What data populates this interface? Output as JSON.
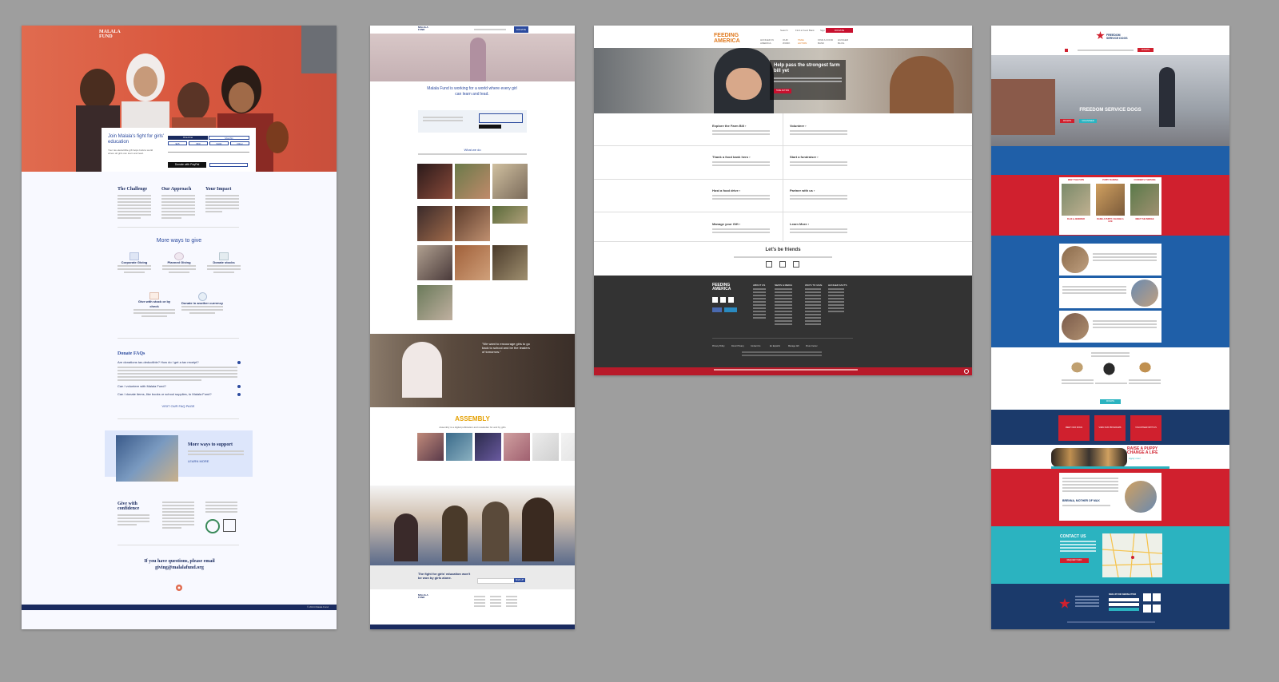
{
  "colors": {
    "canvas": "#9e9e9e",
    "malala_navy": "#1a2b5f",
    "malala_blue": "#2b4a9e",
    "feeding_red": "#c8102e",
    "feeding_orange": "#e07a1f",
    "fsd_red": "#d0202e",
    "fsd_navy": "#1b3a6b",
    "fsd_blue": "#1f5fa8",
    "fsd_teal": "#2bb3c0"
  },
  "panel1": {
    "logo": "MALALA\nFUND",
    "join_title": "Join Malala's fight for girls' education",
    "join_sub": "Your tax-deductible gift helps build a world where all girls can learn and lead.",
    "amounts": [
      "One-time",
      "Monthly",
      "$25",
      "$50",
      "$100",
      "Other"
    ],
    "donate_btn": "Donate with PayPal",
    "cols": [
      {
        "title": "The Challenge"
      },
      {
        "title": "Our Approach"
      },
      {
        "title": "Your Impact"
      }
    ],
    "more_ways_title": "More ways to give",
    "ways": [
      {
        "label": "Corporate Giving",
        "icon": "building-icon"
      },
      {
        "label": "Planned Giving",
        "icon": "heart-icon"
      },
      {
        "label": "Donate stocks",
        "icon": "chart-icon"
      },
      {
        "label": "Give with stock or by check",
        "icon": "mail-icon"
      },
      {
        "label": "Donate in another currency",
        "icon": "globe-icon"
      }
    ],
    "faq_title": "Donate FAQs",
    "faqs": [
      "Are donations tax-deductible? How do I get a tax receipt?",
      "Can I volunteer with Malala Fund?",
      "Can I donate items, like books or school supplies, to Malala Fund?"
    ],
    "faq_link": "VISIT OUR FAQ PAGE",
    "support_title": "More ways to support",
    "support_link": "LEARN MORE",
    "confidence_title": "Give with confidence",
    "questions": "If you have questions, please email giving@malalafund.org",
    "footer": "© 2024 Malala Fund"
  },
  "panel2": {
    "logo": "MALALA\nFUND",
    "nav_btn": "DONATE",
    "headline": "Malala Fund is working for a world where every girl can learn and lead.",
    "join_caption": "Join us",
    "what_we_do": "What we do",
    "quote": "\"We want to encourage girls to go back to school and be the leaders of tomorrow.\"",
    "assembly": "ASSEMBLY",
    "assembly_sub": "Assembly is a digital publication and newsletter for and by girls",
    "newsletter_title": "The fight for girls' education won't be won by girls alone.",
    "newsletter_btn": "SIGN UP"
  },
  "panel3": {
    "logo_top": "FEEDING",
    "logo_bottom": "AMERICA",
    "utility": [
      "Search",
      "Find a Food Bank",
      "Sign Up"
    ],
    "donate_btn": "DONATE",
    "nav": [
      "HUNGER IN AMERICA",
      "OUR WORK",
      "TAKE ACTION",
      "FIND A FOOD BANK",
      "HUNGER BLOG"
    ],
    "hero_title": "Help pass the strongest farm bill yet",
    "hero_btn": "TAKE ACTION",
    "cards": [
      {
        "title": "Explore the Farm Bill ›"
      },
      {
        "title": "Volunteer ›"
      },
      {
        "title": "Thank a food bank hero ›"
      },
      {
        "title": "Start a fundraiser ›"
      },
      {
        "title": "Host a food drive ›"
      },
      {
        "title": "Partner with us ›"
      },
      {
        "title": "Manage your Gift ›"
      },
      {
        "title": "Learn More ›"
      }
    ],
    "friends_title": "Let's be friends",
    "footer_cols": [
      "ABOUT US",
      "NEWS & MEDIA",
      "WAYS TO GIVE",
      "HUNGER FACTS"
    ],
    "footer_links": [
      "Privacy Policy",
      "Donor Privacy",
      "Contact Us",
      "En Español",
      "Manage Gift",
      "Press Center"
    ]
  },
  "panel4": {
    "logo": "FREEDOM\nSERVICE DOGS",
    "nav_donate": "DONATE",
    "hero_title": "FREEDOM SERVICE DOGS",
    "hero_btns": [
      "DONATE",
      "VOLUNTEER"
    ],
    "cards": [
      "MEET THE PUPS",
      "PUPPY RAISING",
      "CURRENTLY SERVING"
    ],
    "card_captions": [
      "FLEX & JENNIFER",
      "RAISE A PUPPY, CHANGE A LIFE",
      "MEET THE BRIDGE"
    ],
    "donate_btn": "DONATE",
    "red_btns": [
      "MEET OUR DOGS",
      "VIEW OUR PROGRAMS",
      "VOLUNTEER WITH US"
    ],
    "banner_title": "RAISE A PUPPY\nCHANGE A LIFE",
    "banner_sub": "Apply now!",
    "testimonial_name": "BRENNA, MOTHER OF MAX",
    "contact_title": "CONTACT US",
    "contact_btn": "REQUEST INFO",
    "newsletter": "SIGN UP FOR NEWSLETTER"
  }
}
